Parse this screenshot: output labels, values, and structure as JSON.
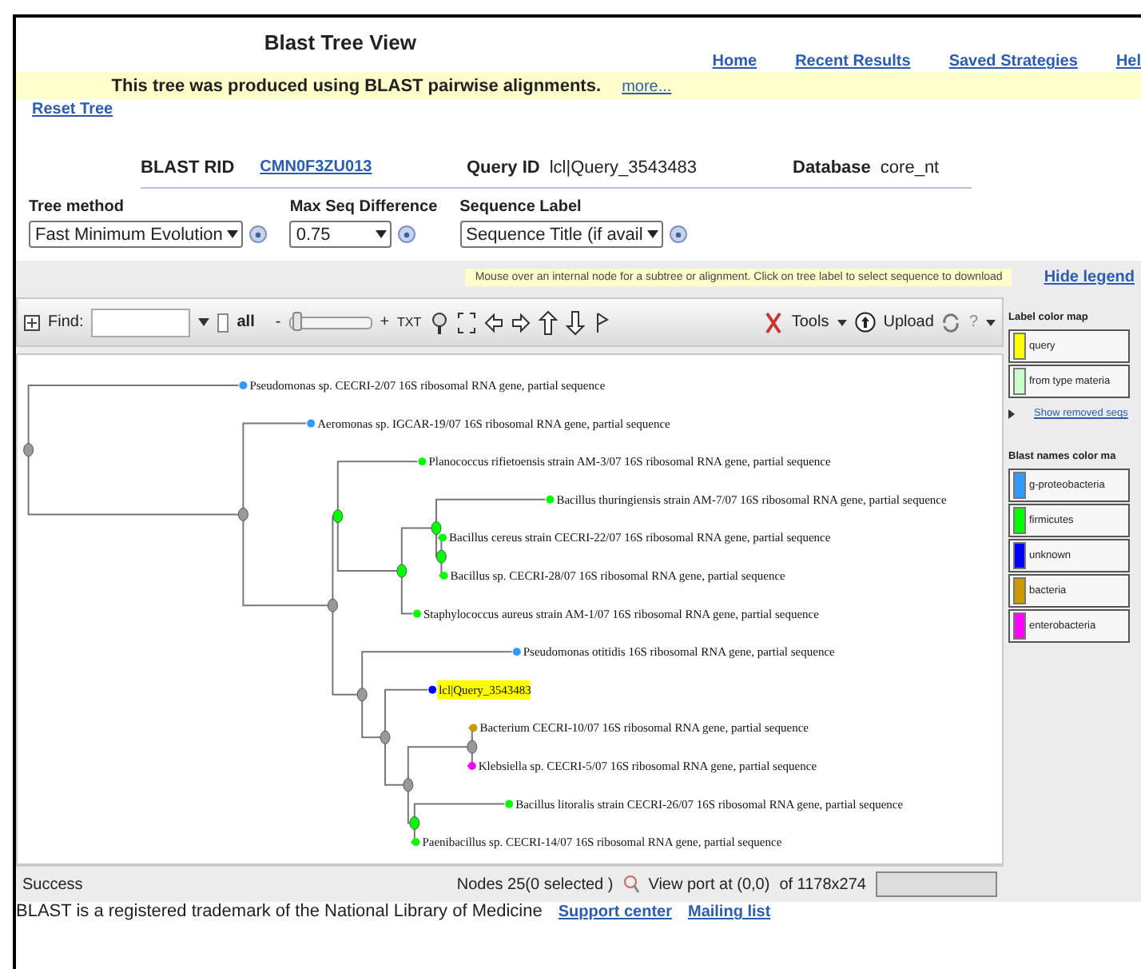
{
  "header": {
    "title": "Blast Tree View",
    "nav": [
      {
        "label": "Home"
      },
      {
        "label": "Recent Results"
      },
      {
        "label": "Saved Strategies"
      },
      {
        "label": "Hel"
      }
    ]
  },
  "notice": {
    "text": "This tree was produced using BLAST pairwise alignments.",
    "link": "more..."
  },
  "reset_link": "Reset Tree",
  "info": [
    {
      "label": "BLAST RID",
      "value": "CMN0F3ZU013",
      "kind": "link"
    },
    {
      "label": "Query ID",
      "value": "lcl|Query_3543483",
      "kind": "text"
    },
    {
      "label": "Database",
      "value": "core_nt",
      "kind": "text"
    }
  ],
  "options": [
    {
      "label": "Tree method",
      "value": "Fast Minimum Evolution"
    },
    {
      "label": "Max Seq Difference",
      "value": "0.75"
    },
    {
      "label": "Sequence Label",
      "value": "Sequence Title (if avail"
    }
  ],
  "hint": "Mouse over an internal node for a subtree or alignment. Click on tree label to select sequence to download",
  "hide_legend": "Hide legend",
  "toolbar": {
    "find_label": "Find:",
    "all_label": "all",
    "all_checked": false,
    "zoom_out": "-",
    "zoom_in": "+",
    "level": 0.03,
    "txt": "TXT",
    "tools": "Tools",
    "upload": "Upload",
    "help": "?"
  },
  "tree": {
    "children": [
      {
        "label": "Pseudomonas sp. CECRI-2/07 16S ribosomal RNA gene, partial sequence",
        "color": "#3399ff",
        "query": false
      },
      {
        "children": [
          {
            "label": "Aeromonas sp. IGCAR-19/07 16S ribosomal RNA gene, partial sequence",
            "color": "#3399ff",
            "query": false
          },
          {
            "children": [
              {
                "children": [
                  {
                    "label": "Planococcus rifietoensis strain AM-3/07 16S ribosomal RNA gene, partial sequence",
                    "color": "#00ff00",
                    "query": false
                  },
                  {
                    "children": [
                      {
                        "children": [
                          {
                            "label": "Bacillus thuringiensis strain AM-7/07 16S ribosomal RNA gene, partial sequence",
                            "color": "#00ff00",
                            "query": false
                          },
                          {
                            "children": [
                              {
                                "label": "Bacillus cereus strain CECRI-22/07 16S ribosomal RNA gene, partial sequence",
                                "color": "#00ff00",
                                "query": false
                              },
                              {
                                "label": "Bacillus sp. CECRI-28/07 16S ribosomal RNA gene, partial sequence",
                                "color": "#00ff00",
                                "query": false
                              }
                            ]
                          }
                        ]
                      },
                      {
                        "label": "Staphylococcus aureus strain AM-1/07 16S ribosomal RNA gene, partial sequence",
                        "color": "#00ff00",
                        "query": false
                      }
                    ]
                  }
                ]
              },
              {
                "children": [
                  {
                    "label": "Pseudomonas otitidis 16S ribosomal RNA gene, partial sequence",
                    "color": "#3399ff",
                    "query": false
                  },
                  {
                    "children": [
                      {
                        "label": "lcl|Query_3543483",
                        "color": "#0000ff",
                        "query": true
                      },
                      {
                        "children": [
                          {
                            "children": [
                              {
                                "label": "Bacterium CECRI-10/07 16S ribosomal RNA gene, partial sequence",
                                "color": "#cc9900",
                                "query": false
                              },
                              {
                                "label": "Klebsiella sp. CECRI-5/07 16S ribosomal RNA gene, partial sequence",
                                "color": "#ff00ff",
                                "query": false
                              }
                            ]
                          },
                          {
                            "children": [
                              {
                                "label": "Bacillus litoralis strain CECRI-26/07 16S ribosomal RNA gene, partial sequence",
                                "color": "#00ff00",
                                "query": false
                              },
                              {
                                "label": "Paenibacillus sp. CECRI-14/07 16S ribosomal RNA gene, partial sequence",
                                "color": "#00ff00",
                                "query": false
                              }
                            ]
                          }
                        ]
                      }
                    ]
                  }
                ]
              }
            ]
          }
        ]
      }
    ]
  },
  "legend": {
    "label_title": "Label color map",
    "label_items": [
      {
        "label": "query",
        "color": "#ffff00"
      },
      {
        "label": "from type materia",
        "color": "#ccffcc"
      }
    ],
    "removed_link": "Show removed seqs",
    "names_title": "Blast names color ma",
    "names_items": [
      {
        "label": "g-proteobacteria",
        "color": "#3399ff"
      },
      {
        "label": "firmicutes",
        "color": "#00ff00"
      },
      {
        "label": "unknown",
        "color": "#0000ff"
      },
      {
        "label": "bacteria",
        "color": "#cc9900"
      },
      {
        "label": "enterobacteria",
        "color": "#ff00ff"
      }
    ]
  },
  "status": {
    "message": "Success",
    "nodes": "Nodes 25(0 selected )",
    "viewport": "View port at (0,0)",
    "size": "of 1178x274"
  },
  "footer": {
    "text": "BLAST is a registered trademark of the National Library of Medicine",
    "links": [
      {
        "label": "Support center"
      },
      {
        "label": "Mailing list"
      }
    ]
  }
}
